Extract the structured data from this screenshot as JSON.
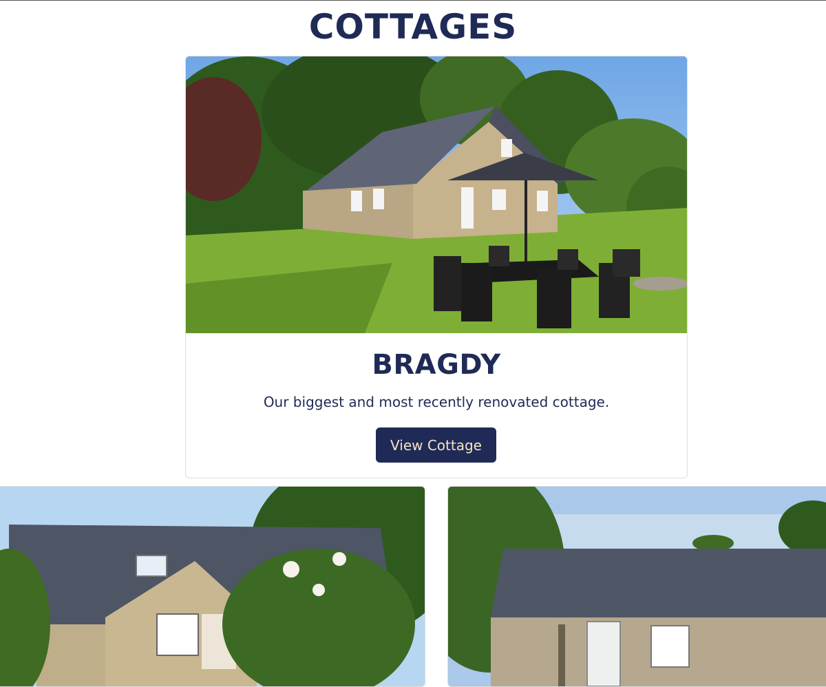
{
  "page": {
    "title": "COTTAGES"
  },
  "featured": {
    "name": "BRAGDY",
    "description": "Our biggest and most recently renovated cottage.",
    "button_label": "View Cottage",
    "photo": "stone-cottage-garden-photo"
  },
  "more_cottages": [
    {
      "photo": "cottage-slate-roof-skylight-photo"
    },
    {
      "photo": "cottage-long-slate-roof-photo"
    }
  ],
  "colors": {
    "navy": "#1f2a56",
    "button_text": "#f3e6c2",
    "card_border": "#dddddd"
  }
}
